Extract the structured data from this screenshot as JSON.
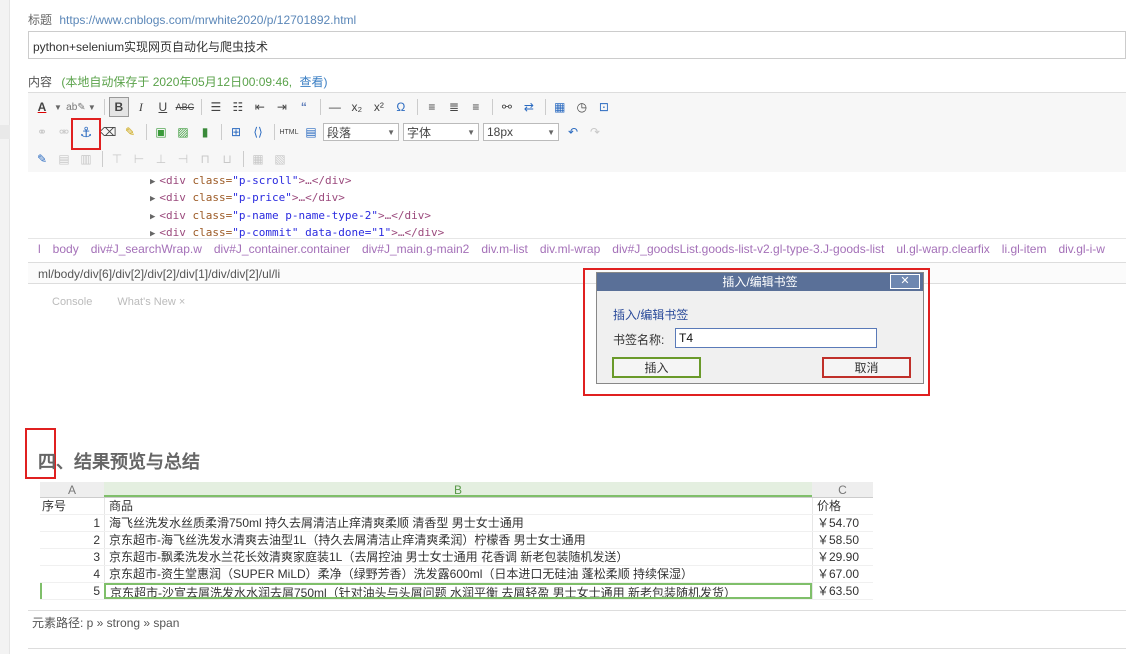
{
  "title_label": "标题",
  "title_url": "https://www.cnblogs.com/mrwhite2020/p/12701892.html",
  "title_input_value": "python+selenium实现网页自动化与爬虫技术",
  "content_label": "内容",
  "autosave_text": "(本地自动保存于 2020年05月12日00:09:46,",
  "autosave_view": "查看)",
  "toolbar": {
    "paragraph_select": "段落",
    "font_select": "字体",
    "size_select": "18px"
  },
  "code_lines": [
    {
      "tag_open": "<div",
      "attr": "class=",
      "val": "\"p-scroll\"",
      "rest": ">…</div>"
    },
    {
      "tag_open": "<div",
      "attr": "class=",
      "val": "\"p-price\"",
      "rest": ">…</div>"
    },
    {
      "tag_open": "<div",
      "attr": "class=",
      "val": "\"p-name p-name-type-2\"",
      "rest": ">…</div>"
    },
    {
      "tag_open": "<div",
      "attr": "class=",
      "val": "\"p-commit\" data-done=\"1\"",
      "rest": ">…</div>"
    }
  ],
  "dom_breadcrumbs": [
    "l",
    "body",
    "div#J_searchWrap.w",
    "div#J_container.container",
    "div#J_main.g-main2",
    "div.m-list",
    "div.ml-wrap",
    "div#J_goodsList.goods-list-v2.gl-type-3.J-goods-list",
    "ul.gl-warp.clearfix",
    "li.gl-item",
    "div.gl-i-w"
  ],
  "dom_path": "ml/body/div[6]/div[2]/div[2]/div[1]/div/div[2]/ul/li",
  "console_tabs": [
    "Console",
    "What's New ×"
  ],
  "dialog": {
    "title": "插入/编辑书签",
    "close": "✕",
    "heading": "插入/编辑书签",
    "field_label": "书签名称:",
    "field_value": "T4",
    "insert_label": "插入",
    "cancel_label": "取消"
  },
  "section_heading": "四、结果预览与总结",
  "sheet": {
    "columns": [
      "A",
      "B",
      "C"
    ],
    "header": {
      "c0": "序号",
      "c1": "商品",
      "c2": "价格"
    },
    "rows": [
      {
        "c0": "1",
        "c1": "海飞丝洗发水丝质柔滑750ml 持久去屑清洁止痒清爽柔顺 清香型 男士女士通用",
        "c2": "￥54.70"
      },
      {
        "c0": "2",
        "c1": "京东超市-海飞丝洗发水清爽去油型1L（持久去屑清洁止痒清爽柔润）柠檬香 男士女士通用",
        "c2": "￥58.50"
      },
      {
        "c0": "3",
        "c1": "京东超市-飘柔洗发水兰花长效清爽家庭装1L（去屑控油 男士女士通用 花香调 新老包装随机发送）",
        "c2": "￥29.90"
      },
      {
        "c0": "4",
        "c1": "京东超市-资生堂惠润（SUPER MiLD）柔净（绿野芳香）洗发露600ml（日本进口无硅油 蓬松柔顺 持续保湿）",
        "c2": "￥67.00"
      },
      {
        "c0": "5",
        "c1": "京东超市-沙宣去屑洗发水水润去屑750ml（针对油头与头屑问题 水润平衡 去屑轻盈 男士女士通用 新老包装随机发货）",
        "c2": "￥63.50"
      }
    ]
  },
  "element_path": "元素路径: p » strong » span"
}
